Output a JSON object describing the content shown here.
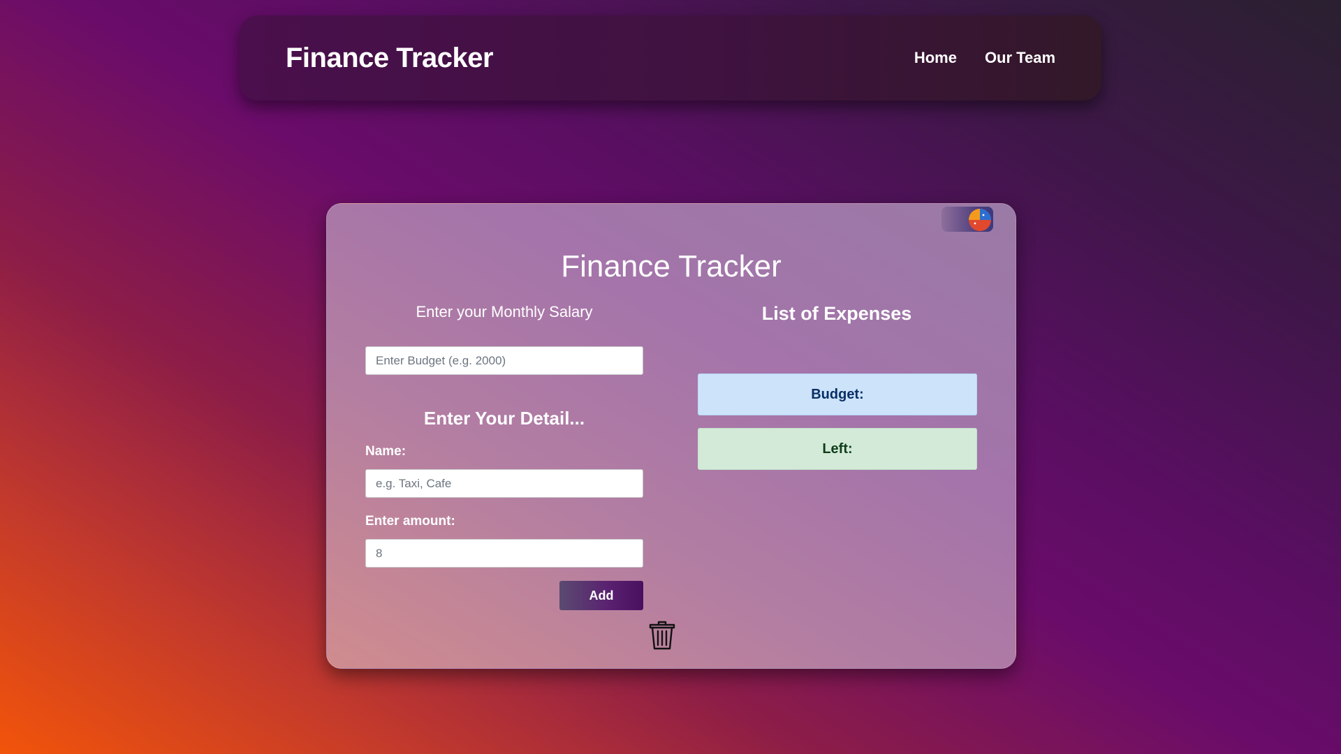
{
  "navbar": {
    "brand": "Finance Tracker",
    "links": [
      {
        "label": "Home"
      },
      {
        "label": "Our Team"
      }
    ]
  },
  "card": {
    "title": "Finance Tracker",
    "chart_toggle_icon": "pie-chart-icon",
    "salary": {
      "label": "Enter your Monthly Salary",
      "placeholder": "Enter Budget (e.g. 2000)",
      "value": ""
    },
    "detail": {
      "heading": "Enter Your Detail...",
      "name_label": "Name:",
      "name_placeholder": "e.g. Taxi, Cafe",
      "name_value": "",
      "amount_label": "Enter amount:",
      "amount_placeholder": "8",
      "amount_value": "",
      "add_label": "Add",
      "delete_icon": "trash-icon"
    },
    "expenses": {
      "heading": "List of Expenses",
      "budget_label": "Budget:",
      "left_label": "Left:"
    }
  },
  "colors": {
    "budget_box_bg": "#cce3fa",
    "left_box_bg": "#d3ead8",
    "navbar_bg": "#4a0f4c"
  }
}
